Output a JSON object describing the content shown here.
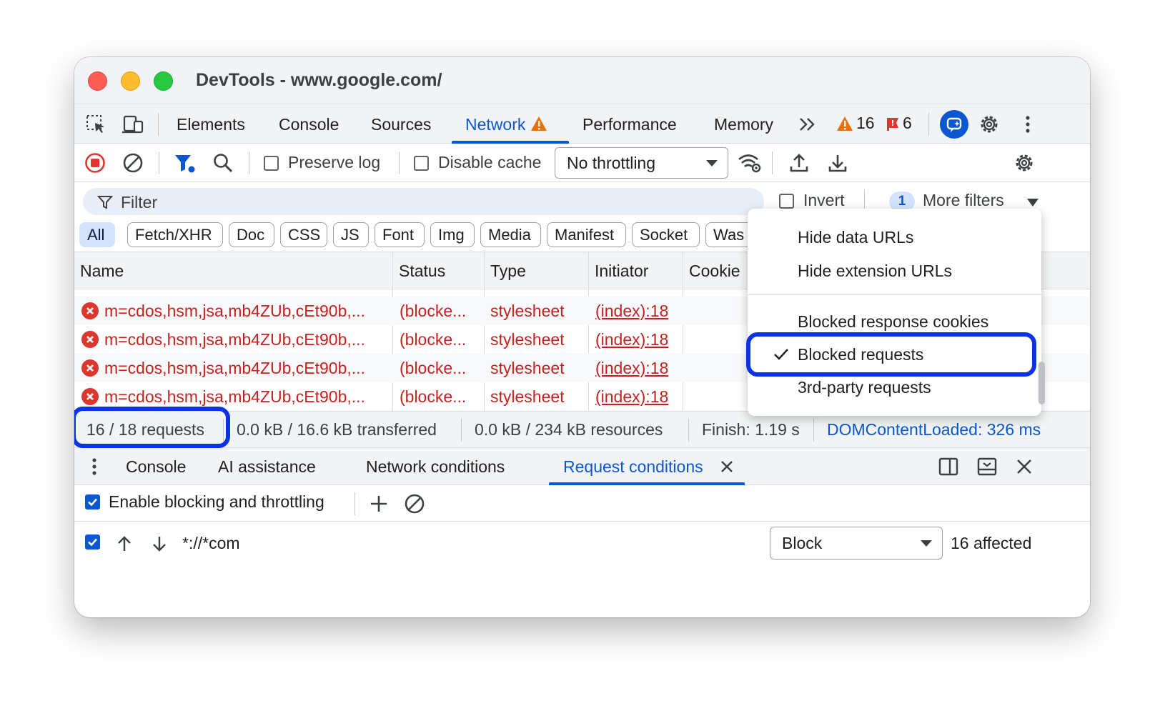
{
  "window": {
    "title": "DevTools - www.google.com/"
  },
  "tabs": {
    "items": [
      "Elements",
      "Console",
      "Sources",
      "Network",
      "Performance",
      "Memory"
    ],
    "warnings_count": "16",
    "errors_count": "6"
  },
  "toolbar": {
    "preserve_log": "Preserve log",
    "disable_cache": "Disable cache",
    "throttling": "No throttling"
  },
  "filter": {
    "placeholder": "Filter",
    "invert": "Invert",
    "more_filters_count": "1",
    "more_filters": "More filters"
  },
  "types": [
    "All",
    "Fetch/XHR",
    "Doc",
    "CSS",
    "JS",
    "Font",
    "Img",
    "Media",
    "Manifest",
    "Socket",
    "Was"
  ],
  "table": {
    "columns": [
      "Name",
      "Status",
      "Type",
      "Initiator",
      "Cookie"
    ],
    "rows": [
      {
        "name": "m=cdos,hsm,jsa,mb4ZUb,cEt90b,...",
        "status": "(blocke...",
        "type": "stylesheet",
        "initiator": "(index):18"
      },
      {
        "name": "m=cdos,hsm,jsa,mb4ZUb,cEt90b,...",
        "status": "(blocke...",
        "type": "stylesheet",
        "initiator": "(index):18"
      },
      {
        "name": "m=cdos,hsm,jsa,mb4ZUb,cEt90b,...",
        "status": "(blocke...",
        "type": "stylesheet",
        "initiator": "(index):18"
      },
      {
        "name": "m=cdos,hsm,jsa,mb4ZUb,cEt90b,...",
        "status": "(blocke...",
        "type": "stylesheet",
        "initiator": "(index):18"
      }
    ]
  },
  "status_bar": {
    "requests": "16 / 18 requests",
    "transferred": "0.0 kB / 16.6 kB transferred",
    "resources": "0.0 kB / 234 kB resources",
    "finish": "Finish: 1.19 s",
    "dcl": "DOMContentLoaded: 326 ms"
  },
  "more_filters_menu": {
    "items": [
      "Hide data URLs",
      "Hide extension URLs",
      "Blocked response cookies",
      "Blocked requests",
      "3rd-party requests"
    ],
    "checked": "Blocked requests"
  },
  "drawer": {
    "tabs": [
      "Console",
      "AI assistance",
      "Network conditions",
      "Request conditions"
    ],
    "active": "Request conditions"
  },
  "request_conditions": {
    "enable_label": "Enable blocking and throttling",
    "pattern": "*://*com",
    "action": "Block",
    "affected": "16 affected"
  },
  "colors": {
    "accent": "#0b57d0",
    "error": "#c5221f",
    "highlight": "#0b33e6"
  }
}
